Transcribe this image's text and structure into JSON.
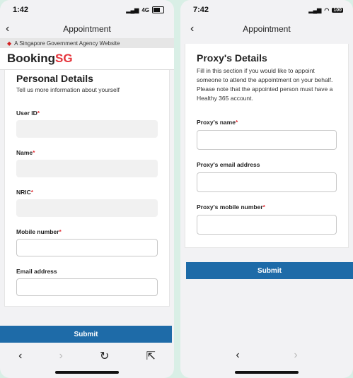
{
  "left": {
    "status": {
      "time": "1:42",
      "network": "4G"
    },
    "nav": {
      "title": "Appointment",
      "back_icon": "chevron-left-icon"
    },
    "gov_banner": "A Singapore Government Agency Website",
    "brand": {
      "part1": "Booking",
      "part2": "SG"
    },
    "section": {
      "title": "Personal Details",
      "subtitle": "Tell us more information about yourself"
    },
    "fields": [
      {
        "label": "User ID",
        "required": "*",
        "value": "",
        "state": "disabled"
      },
      {
        "label": "Name",
        "required": "*",
        "value": "",
        "state": "disabled"
      },
      {
        "label": "NRIC",
        "required": "*",
        "value": "",
        "state": "disabled"
      },
      {
        "label": "Mobile number",
        "required": "*",
        "value": "",
        "state": "enabled"
      },
      {
        "label": "Email address",
        "required": "",
        "value": "",
        "state": "enabled"
      }
    ],
    "submit_label": "Submit",
    "browser_bar": {
      "back": "‹",
      "forward": "›",
      "reload": "↻",
      "share": "⇱"
    }
  },
  "right": {
    "status": {
      "time": "7:42",
      "battery": "100"
    },
    "nav": {
      "title": "Appointment",
      "back_icon": "chevron-left-icon"
    },
    "section": {
      "title": "Proxy's Details",
      "subtitle": "Fill in this section if you would like to appoint someone to attend the appointment on your behalf. Please note that the appointed person must have a Healthy 365 account."
    },
    "fields": [
      {
        "label": "Proxy's name",
        "required": "*"
      },
      {
        "label": "Proxy's email address",
        "required": ""
      },
      {
        "label": "Proxy's mobile number",
        "required": "*"
      }
    ],
    "submit_label": "Submit",
    "browser_bar": {
      "back": "‹",
      "forward": "›"
    }
  },
  "colors": {
    "accent": "#1e6ba8",
    "brand_red": "#e5343b",
    "background": "#d9efe6"
  }
}
